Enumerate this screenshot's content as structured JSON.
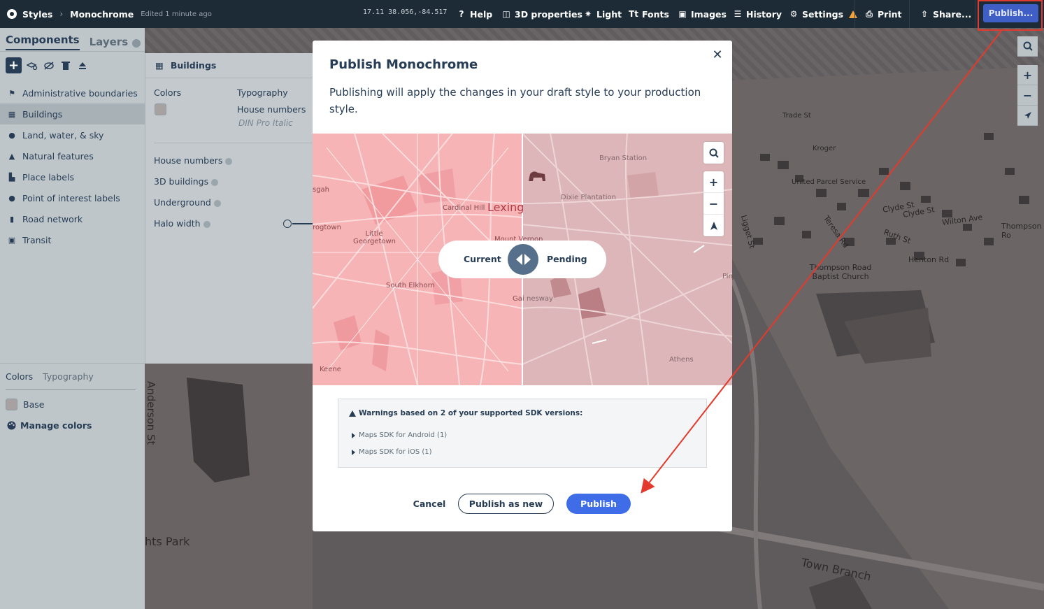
{
  "topbar": {
    "breadcrumb_root": "Styles",
    "style_name": "Monochrome",
    "edited": "Edited 1 minute ago",
    "zoom": "17.11",
    "coordinates": "38.056,-84.517",
    "help": "Help",
    "props_3d": "3D properties",
    "light": "Light",
    "fonts": "Fonts",
    "images": "Images",
    "history": "History",
    "settings": "Settings",
    "print": "Print",
    "share": "Share...",
    "publish": "Publish..."
  },
  "sidebar": {
    "tab_components": "Components",
    "tab_layers": "Layers",
    "items": [
      {
        "label": "Administrative boundaries",
        "icon": "flag-icon"
      },
      {
        "label": "Buildings",
        "icon": "building-icon"
      },
      {
        "label": "Land, water, & sky",
        "icon": "globe-icon"
      },
      {
        "label": "Natural features",
        "icon": "mountain-icon"
      },
      {
        "label": "Place labels",
        "icon": "city-icon"
      },
      {
        "label": "Point of interest labels",
        "icon": "pin-icon"
      },
      {
        "label": "Road network",
        "icon": "road-icon"
      },
      {
        "label": "Transit",
        "icon": "train-icon"
      }
    ],
    "bottom_tab_colors": "Colors",
    "bottom_tab_typography": "Typography",
    "base_label": "Base",
    "manage_colors": "Manage colors"
  },
  "panel": {
    "title": "Buildings",
    "colors_label": "Colors",
    "typography_label": "Typography",
    "font_target": "House numbers",
    "font_name": "DIN Pro Italic",
    "house_numbers": "House numbers",
    "buildings_3d": "3D buildings",
    "underground": "Underground",
    "halo_width": "Halo width"
  },
  "map": {
    "anderson": "Anderson St",
    "park": "hts Park",
    "town_branch": "Town Branch",
    "clyde": "Clyde St",
    "wilton": "Wilton Ave",
    "henton": "Henton Rd",
    "thompson": "Thompson Ro",
    "teresa": "Teresa Rd",
    "church": "Thompson Road Baptist Church",
    "ligget": "Ligget St",
    "clyde2": "Clyde St",
    "ruth": "Ruth St",
    "ups": "United Parcel Service",
    "kroger": "Kroger",
    "trade": "Trade St"
  },
  "modal": {
    "title": "Publish Monochrome",
    "description": "Publishing will apply the changes in your draft style to your production style.",
    "compare_current": "Current",
    "compare_pending": "Pending",
    "preview_labels": {
      "lexington": "Lexing",
      "cardinal_hill": "Cardinal Hill",
      "little_georgetown": "Little Georgetown",
      "south_elkhorn": "South Elkhorn",
      "keene": "Keene",
      "rogtown": "rogtown",
      "sgah": "sgah",
      "bryan_station": "Bryan Station",
      "dixie": "Dixie Plantation",
      "gainesway": "nesway",
      "gainesway_left": "Gai",
      "athens": "Athens",
      "mount_vernon": "Mount Vernon",
      "pin": "Pin"
    },
    "warning_title": "Warnings based on 2 of your supported SDK versions:",
    "warning_android": "Maps SDK for Android (1)",
    "warning_ios": "Maps SDK for iOS (1)",
    "cancel": "Cancel",
    "publish_as_new": "Publish as new",
    "publish": "Publish"
  },
  "colors": {
    "accent": "#3f6de8",
    "annotation": "#e23a2c",
    "warning": "#f2a33a"
  }
}
